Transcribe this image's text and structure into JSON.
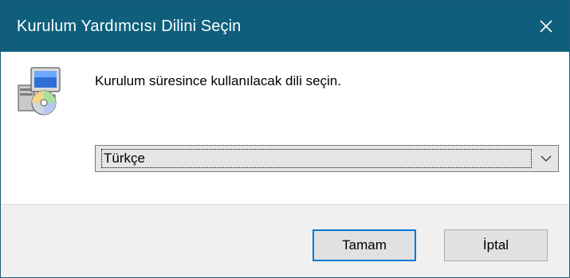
{
  "window": {
    "title": "Kurulum Yardımcısı Dilini Seçin",
    "close_glyph": "✕"
  },
  "content": {
    "icon": "setup-installer-icon",
    "message": "Kurulum süresince kullanılacak dili seçin."
  },
  "language_select": {
    "selected": "Türkçe",
    "arrow_icon": "chevron-down-icon"
  },
  "buttons": {
    "ok_label": "Tamam",
    "cancel_label": "İptal"
  },
  "colors": {
    "titlebar": "#0f5f7c",
    "default_button_border": "#0078d7",
    "footer": "#f0f0f0"
  }
}
